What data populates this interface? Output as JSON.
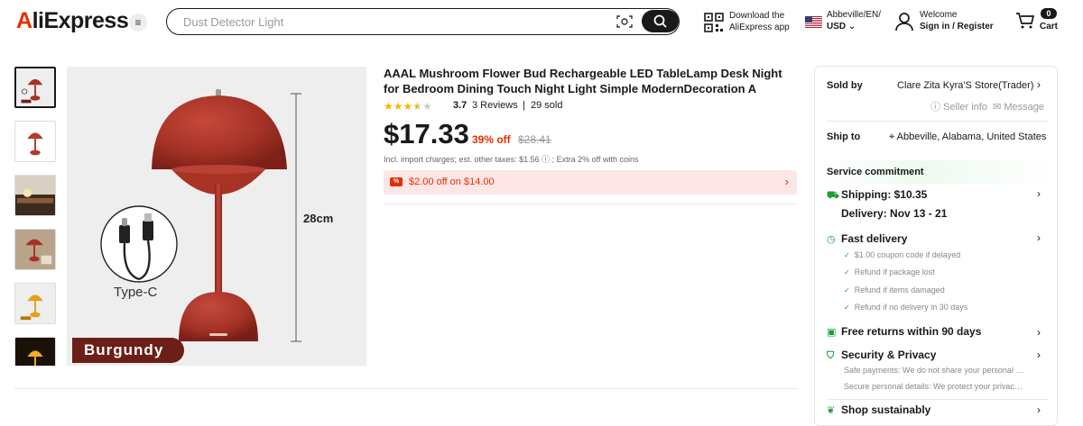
{
  "header": {
    "logo_text": "AliExpress",
    "menu_icon": "hamburger-icon",
    "search_placeholder": "Dust Detector Light",
    "app_download_line1": "Download the",
    "app_download_line2": "AliExpress app",
    "locale_line1": "Abbeville/EN/",
    "locale_line2": "USD",
    "account_line1": "Welcome",
    "account_line2": "Sign in / Register",
    "cart_count": "0",
    "cart_label": "Cart"
  },
  "gallery": {
    "thumbnail_count": 6,
    "active_thumbnail": 0,
    "main_image_labels": {
      "size": "28cm",
      "connector": "Type-C",
      "color": "Burgundy"
    }
  },
  "product": {
    "title": "AAAL Mushroom Flower Bud Rechargeable LED TableLamp Desk Night for Bedroom Dining Touch Night Light Simple ModernDecoration A",
    "rating_value": 3.7,
    "rating_text": "3.7",
    "reviews_text": "3 Reviews",
    "separator": "|",
    "sold_text": "29 sold",
    "price": "$17.33",
    "discount": "39% off",
    "original_price": "$28.41",
    "tax_note": "Incl. import charges; est. other taxes: $1.56 ⓘ ; Extra 2% off with coins",
    "coupon_icon_text": "%",
    "coupon_text": "$2.00 off on $14.00"
  },
  "panel": {
    "sold_by_label": "Sold by",
    "seller_name": "Clare Zita Kyra'S Store(Trader)",
    "seller_info": "Seller info",
    "message": "Message",
    "ship_to_label": "Ship to",
    "ship_to_value": "Abbeville, Alabama, United States",
    "service_commitment": "Service commitment",
    "shipping": "Shipping: $10.35",
    "delivery": "Delivery: Nov 13 - 21",
    "fast_delivery": "Fast delivery",
    "fast_delivery_items": [
      "$1.00 coupon code if delayed",
      "Refund if package lost",
      "Refund if items damaged",
      "Refund if no delivery in 30 days"
    ],
    "free_returns": "Free returns within 90 days",
    "security": "Security & Privacy",
    "security_items": [
      "Safe payments: We do not share your personal details with any third parties",
      "Secure personal details: We protect your privacy and keep your data safe"
    ],
    "shop_sustainably": "Shop sustainably"
  },
  "colors": {
    "brand_red": "#e62e04",
    "dark": "#191919",
    "green": "#1a9e3a",
    "lamp_red": "#a83226"
  }
}
